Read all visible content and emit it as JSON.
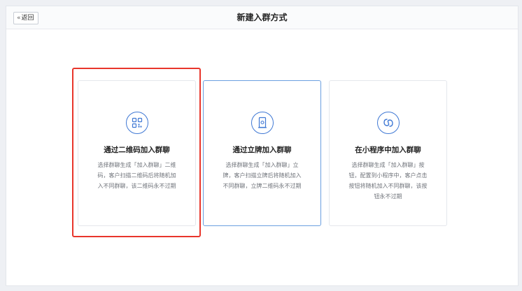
{
  "header": {
    "back_label": "返回",
    "title": "新建入群方式"
  },
  "cards": [
    {
      "title": "通过二维码加入群聊",
      "description": "选择群聊生成「加入群聊」二维码，客户扫描二维码后将随机加入不同群聊，该二维码永不过期",
      "icon": "qr-code-icon",
      "selected": true
    },
    {
      "title": "通过立牌加入群聊",
      "description": "选择群聊生成「加入群聊」立牌，客户扫描立牌后将随机加入不同群聊，立牌二维码永不过期",
      "icon": "stand-sign-icon",
      "hovered": true
    },
    {
      "title": "在小程序中加入群聊",
      "description": "选择群聊生成「加入群聊」按钮，配置到小程序中，客户点击按钮将随机加入不同群聊，该按钮永不过期",
      "icon": "mini-program-icon"
    }
  ],
  "colors": {
    "accent": "#3f78d4",
    "selection_border": "#e8352b",
    "hover_border": "#6a9fe0"
  }
}
